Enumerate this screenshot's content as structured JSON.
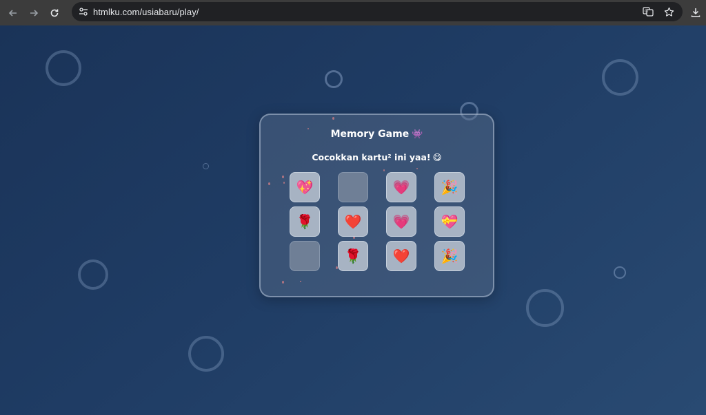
{
  "browser": {
    "url": "htmlku.com/usiabaru/play/",
    "back_icon": "back-arrow-icon",
    "forward_icon": "forward-arrow-icon",
    "reload_icon": "reload-icon",
    "site_info_icon": "tune-icon",
    "translate_icon": "translate-icon",
    "bookmark_icon": "star-icon",
    "download_icon": "download-icon"
  },
  "game": {
    "title": "Memory Game",
    "title_emoji": "👾",
    "subtitle": "Cocokkan kartu² ini yaa!",
    "subtitle_emoji": "😋",
    "cards": [
      {
        "face": "💖",
        "state": "revealed"
      },
      {
        "face": "",
        "state": "hidden"
      },
      {
        "face": "💗",
        "state": "revealed"
      },
      {
        "face": "🎉",
        "state": "revealed"
      },
      {
        "face": "🌹",
        "state": "revealed"
      },
      {
        "face": "❤️",
        "state": "revealed"
      },
      {
        "face": "💗",
        "state": "revealed"
      },
      {
        "face": "💝",
        "state": "revealed"
      },
      {
        "face": "",
        "state": "hidden"
      },
      {
        "face": "🌹",
        "state": "revealed"
      },
      {
        "face": "❤️",
        "state": "revealed"
      },
      {
        "face": "🎉",
        "state": "revealed"
      }
    ]
  },
  "colors": {
    "background": "#1f3c64",
    "card_revealed": "#a7b3c3",
    "card_hidden": "#6f7f96",
    "confetti": "#f07878"
  }
}
